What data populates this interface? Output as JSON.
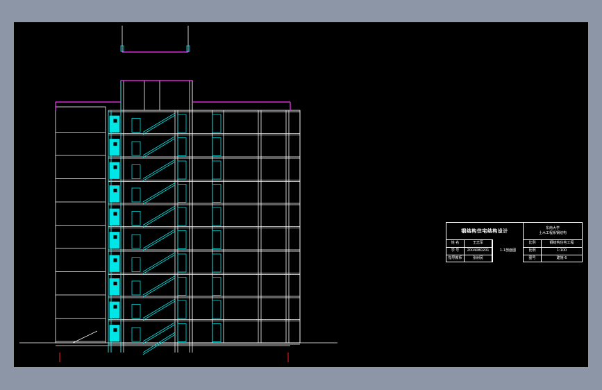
{
  "drawing": {
    "colors": {
      "background": "#000000",
      "outline": "#ffffff",
      "stair": "#00e5e5",
      "roof": "#ff33ff",
      "marker": "#ff2020"
    }
  },
  "title_block": {
    "project_title": "钢结构住宅结构设计",
    "school_line1": "东南大学",
    "school_line2": "土木工程系钢结构",
    "designer_label": "姓 名",
    "designer_value": "王志军",
    "student_id_label": "学 号",
    "student_id_value": "2004080201",
    "advisor_label": "指导教师",
    "advisor_value": "张树民",
    "drawing_name": "1-1剖面图",
    "item1_label": "比例",
    "item1_value": "钢结构住宅工程",
    "item2_label": "比例",
    "item2_value": "1:100",
    "item3_label": "图号",
    "item3_value": "建施-6"
  }
}
